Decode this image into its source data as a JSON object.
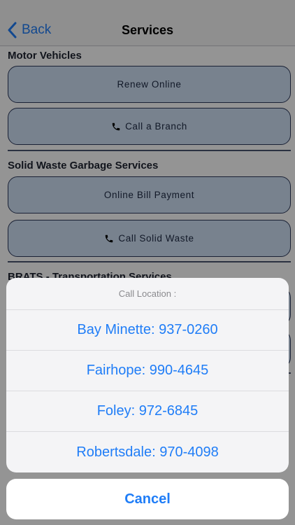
{
  "navbar": {
    "back_label": "Back",
    "title": "Services"
  },
  "sections": [
    {
      "title": "Motor Vehicles",
      "buttons": [
        "Renew Online",
        "Call a Branch"
      ]
    },
    {
      "title": "Solid Waste Garbage Services",
      "buttons": [
        "Online Bill Payment",
        "Call Solid Waste"
      ]
    },
    {
      "title": "BRATS - Transportation Services"
    }
  ],
  "action_sheet": {
    "title": "Call Location :",
    "options": [
      "Bay Minette: 937-0260",
      "Fairhope: 990-4645",
      "Foley: 972-6845",
      "Robertsdale: 970-4098"
    ],
    "cancel_label": "Cancel"
  },
  "colors": {
    "accent": "#1f7df7",
    "button_fill": "#cfe0f5",
    "button_border": "#2d3a5c"
  },
  "icons": {
    "back": "chevron-left-icon",
    "phone": "phone-icon"
  }
}
